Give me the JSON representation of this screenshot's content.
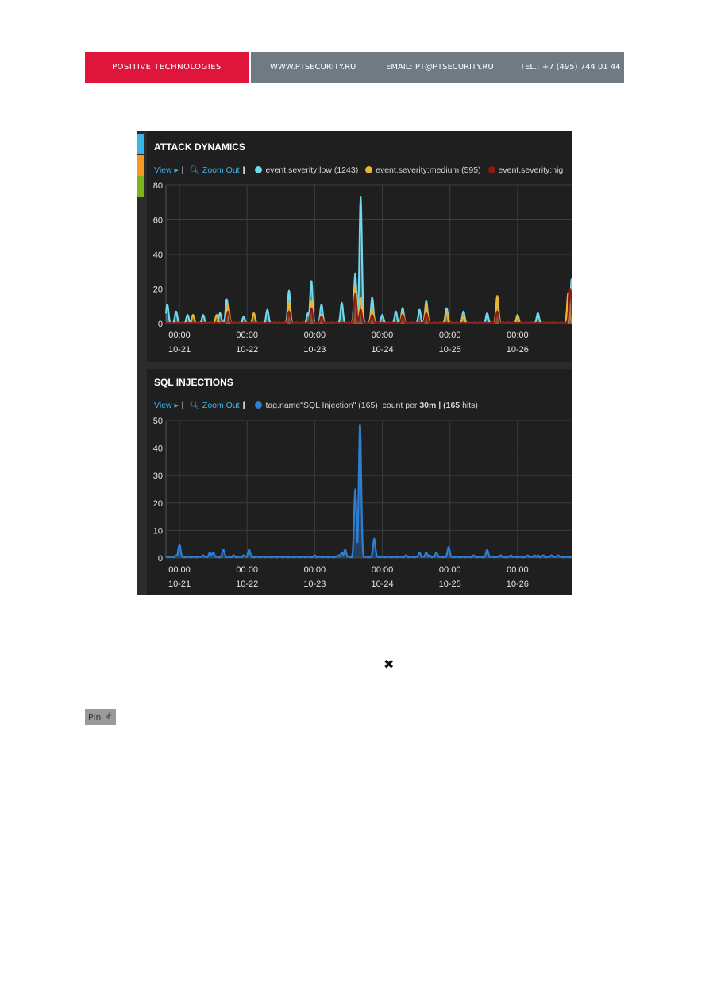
{
  "header": {
    "brand": "POSITIVE TECHNOLOGIES",
    "website": "WWW.PTSECURITY.RU",
    "email": "EMAIL: PT@PTSECURITY.RU",
    "phone": "TEL.: +7 (495) 744 01 44"
  },
  "colors": {
    "brand_red": "#e0153b",
    "header_gray": "#6f7a83",
    "strip_blue": "#3bb4e6",
    "strip_orange": "#f39a1f",
    "strip_green": "#7ab51d",
    "low": "#6fd8ee",
    "medium": "#e8b533",
    "high": "#8b1a12",
    "sql": "#2f7fd1"
  },
  "attack_panel": {
    "title": "ATTACK DYNAMICS",
    "view_label": "View ▸",
    "zoom_label": "Zoom Out",
    "legend": [
      {
        "label": "event.severity:low (1243)",
        "color": "#6fd8ee"
      },
      {
        "label": "event.severity:medium (595)",
        "color": "#e8b533"
      },
      {
        "label": "event.severity:hig",
        "color": "#8b1a12"
      }
    ]
  },
  "sql_panel": {
    "title": "SQL INJECTIONS",
    "view_label": "View ▸",
    "zoom_label": "Zoom Out",
    "legend_label": "tag.name\"SQL Injection\" (165)",
    "count_prefix": "count per",
    "count_interval": "30m",
    "count_hits_open": "| (",
    "count_hits": "165",
    "count_hits_close": "hits)"
  },
  "chart_data": [
    {
      "type": "area",
      "title": "ATTACK DYNAMICS",
      "x_ticks": [
        {
          "time": "00:00",
          "date": "10-21"
        },
        {
          "time": "00:00",
          "date": "10-22"
        },
        {
          "time": "00:00",
          "date": "10-23"
        },
        {
          "time": "00:00",
          "date": "10-24"
        },
        {
          "time": "00:00",
          "date": "10-25"
        },
        {
          "time": "00:00",
          "date": "10-26"
        }
      ],
      "y_ticks": [
        0,
        20,
        40,
        60,
        80
      ],
      "ylim": [
        0,
        80
      ],
      "xlim_days": [
        -0.2,
        5.8
      ],
      "grid": true,
      "legend_position": "top",
      "series": [
        {
          "name": "event.severity:low (1243)",
          "color": "#6fd8ee",
          "peaks": [
            [
              -0.18,
              11
            ],
            [
              -0.05,
              7
            ],
            [
              0.12,
              5
            ],
            [
              0.35,
              5
            ],
            [
              0.6,
              6
            ],
            [
              0.7,
              14
            ],
            [
              0.95,
              4
            ],
            [
              1.3,
              8
            ],
            [
              1.62,
              19
            ],
            [
              1.9,
              6
            ],
            [
              1.95,
              25
            ],
            [
              2.1,
              11
            ],
            [
              2.4,
              12
            ],
            [
              2.6,
              29
            ],
            [
              2.68,
              73
            ],
            [
              2.85,
              15
            ],
            [
              3.0,
              5
            ],
            [
              3.2,
              7
            ],
            [
              3.3,
              9
            ],
            [
              3.55,
              8
            ],
            [
              3.65,
              13
            ],
            [
              3.95,
              9
            ],
            [
              4.2,
              7
            ],
            [
              4.55,
              6
            ],
            [
              4.7,
              12
            ],
            [
              5.0,
              5
            ],
            [
              5.3,
              6
            ],
            [
              5.8,
              26
            ]
          ]
        },
        {
          "name": "event.severity:medium (595)",
          "color": "#e8b533",
          "peaks": [
            [
              0.2,
              5
            ],
            [
              0.55,
              5
            ],
            [
              0.72,
              11
            ],
            [
              1.1,
              6
            ],
            [
              1.62,
              12
            ],
            [
              1.95,
              13
            ],
            [
              2.1,
              5
            ],
            [
              2.6,
              22
            ],
            [
              2.68,
              15
            ],
            [
              2.85,
              9
            ],
            [
              3.3,
              7
            ],
            [
              3.65,
              11
            ],
            [
              3.95,
              7
            ],
            [
              4.2,
              4
            ],
            [
              4.7,
              16
            ],
            [
              5.0,
              4
            ],
            [
              5.75,
              18
            ]
          ]
        },
        {
          "name": "event.severity:hig",
          "color": "#8b1a12",
          "peaks": [
            [
              0.72,
              7
            ],
            [
              1.62,
              7
            ],
            [
              1.95,
              9
            ],
            [
              2.1,
              4
            ],
            [
              2.6,
              17
            ],
            [
              2.68,
              8
            ],
            [
              2.85,
              5
            ],
            [
              3.3,
              5
            ],
            [
              3.65,
              6
            ],
            [
              4.7,
              7
            ],
            [
              5.78,
              20
            ]
          ]
        }
      ]
    },
    {
      "type": "area",
      "title": "SQL INJECTIONS",
      "x_ticks": [
        {
          "time": "00:00",
          "date": "10-21"
        },
        {
          "time": "00:00",
          "date": "10-22"
        },
        {
          "time": "00:00",
          "date": "10-23"
        },
        {
          "time": "00:00",
          "date": "10-24"
        },
        {
          "time": "00:00",
          "date": "10-25"
        },
        {
          "time": "00:00",
          "date": "10-26"
        }
      ],
      "y_ticks": [
        0,
        10,
        20,
        30,
        40,
        50
      ],
      "ylim": [
        0,
        50
      ],
      "xlim_days": [
        -0.2,
        5.8
      ],
      "grid": true,
      "legend_position": "top",
      "series": [
        {
          "name": "tag.name\"SQL Injection\" (165)",
          "color": "#2f7fd1",
          "peaks": [
            [
              -0.05,
              1
            ],
            [
              0.0,
              5
            ],
            [
              0.35,
              1
            ],
            [
              0.45,
              2
            ],
            [
              0.5,
              2
            ],
            [
              0.65,
              3
            ],
            [
              0.8,
              1
            ],
            [
              0.95,
              1
            ],
            [
              1.03,
              3
            ],
            [
              2.0,
              1
            ],
            [
              2.35,
              1
            ],
            [
              2.4,
              2
            ],
            [
              2.45,
              3
            ],
            [
              2.6,
              25
            ],
            [
              2.67,
              49
            ],
            [
              2.88,
              7
            ],
            [
              3.35,
              1
            ],
            [
              3.55,
              2
            ],
            [
              3.65,
              2
            ],
            [
              3.7,
              1
            ],
            [
              3.8,
              2
            ],
            [
              3.98,
              4
            ],
            [
              4.35,
              1
            ],
            [
              4.55,
              3
            ],
            [
              4.75,
              1
            ],
            [
              4.9,
              1
            ],
            [
              5.15,
              1
            ],
            [
              5.25,
              1
            ],
            [
              5.3,
              1
            ],
            [
              5.38,
              1
            ],
            [
              5.5,
              1
            ],
            [
              5.6,
              1
            ]
          ]
        }
      ]
    }
  ],
  "popup": {
    "close_glyph": "✖",
    "pin_label": "Pin",
    "pin_glyph": "📌"
  }
}
